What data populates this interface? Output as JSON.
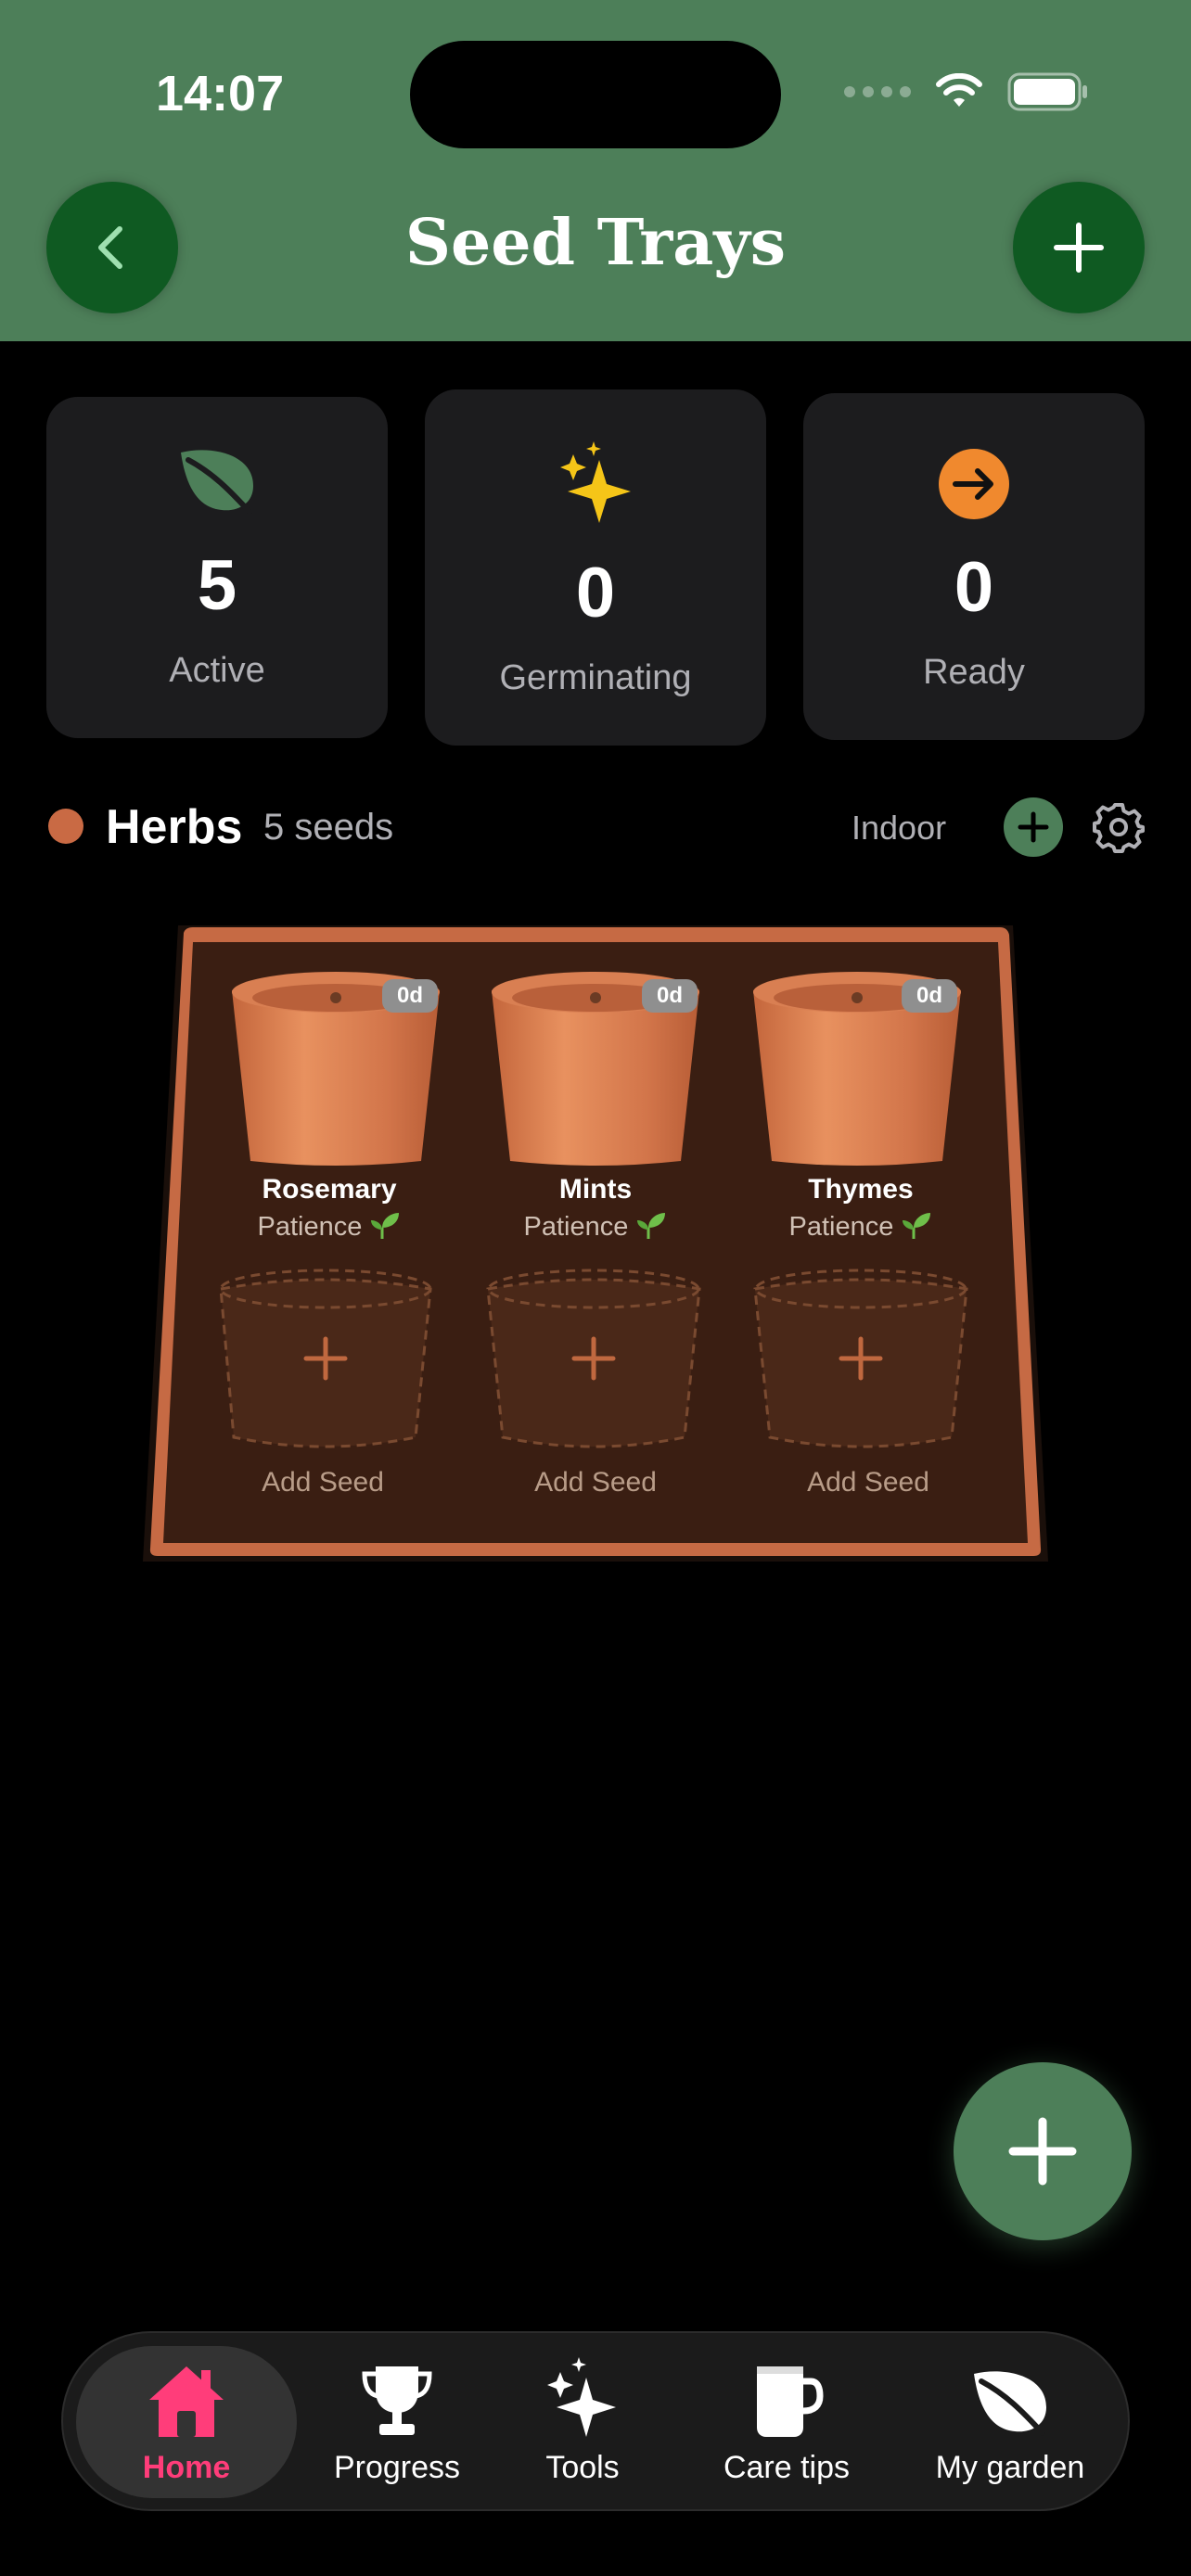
{
  "status_bar": {
    "time": "14:07"
  },
  "header": {
    "title": "Seed Trays",
    "back_icon": "chevron-left-icon",
    "add_icon": "plus-icon"
  },
  "stats": [
    {
      "value": "5",
      "label": "Active",
      "icon": "leaf-icon",
      "color": "#4d7f59"
    },
    {
      "value": "0",
      "label": "Germinating",
      "icon": "sparkles-icon",
      "color": "#f5c518"
    },
    {
      "value": "0",
      "label": "Ready",
      "icon": "arrow-right-circle-icon",
      "color": "#f0892e"
    }
  ],
  "section": {
    "name": "Herbs",
    "count": "5 seeds",
    "environment": "Indoor",
    "dot_color": "#c96a44"
  },
  "tray": {
    "pots": [
      {
        "name": "Rosemary",
        "status": "Patience",
        "age": "0d"
      },
      {
        "name": "Mints",
        "status": "Patience",
        "age": "0d"
      },
      {
        "name": "Thymes",
        "status": "Patience",
        "age": "0d"
      }
    ],
    "empty_slots": [
      {
        "label": "Add Seed"
      },
      {
        "label": "Add Seed"
      },
      {
        "label": "Add Seed"
      }
    ]
  },
  "tabs": [
    {
      "label": "Home",
      "icon": "house-icon",
      "active": true
    },
    {
      "label": "Progress",
      "icon": "trophy-icon",
      "active": false
    },
    {
      "label": "Tools",
      "icon": "sparkles-icon",
      "active": false
    },
    {
      "label": "Care tips",
      "icon": "mug-icon",
      "active": false
    },
    {
      "label": "My garden",
      "icon": "leaf-icon",
      "active": false
    }
  ],
  "colors": {
    "header_green": "#4d7f59",
    "button_green": "#0f5a22",
    "accent_pink": "#ff3d7a",
    "terracotta": "#c96a44"
  }
}
